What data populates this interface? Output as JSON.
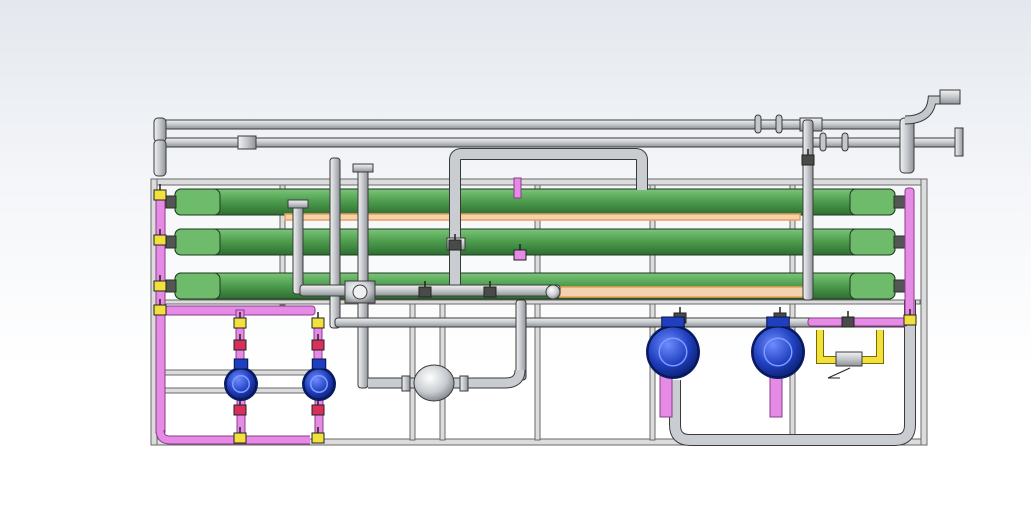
{
  "scene": {
    "background_top": "#e4e8ee",
    "background_bottom": "#ffffff",
    "colors": {
      "membrane_vessel": "#4f9f4f",
      "pipe_steel": "#c4c8cc",
      "pipe_outline": "#3a3a3a",
      "pipe_pink": "#e58be6",
      "pipe_orange": "#e8a15c",
      "pump_blue": "#1f3fbf",
      "valve_yellow": "#f2e13c",
      "valve_red": "#d8305a",
      "frame": "#d9d9d9"
    }
  },
  "components": {
    "membrane_vessels": [
      {
        "name": "vessel-1"
      },
      {
        "name": "vessel-2"
      },
      {
        "name": "vessel-3"
      }
    ],
    "pumps": [
      {
        "name": "small-pump-1",
        "size": "small"
      },
      {
        "name": "small-pump-2",
        "size": "small"
      },
      {
        "name": "large-pump-1",
        "size": "large"
      },
      {
        "name": "large-pump-2",
        "size": "large"
      }
    ],
    "tank": {
      "name": "cartridge-filter"
    }
  }
}
